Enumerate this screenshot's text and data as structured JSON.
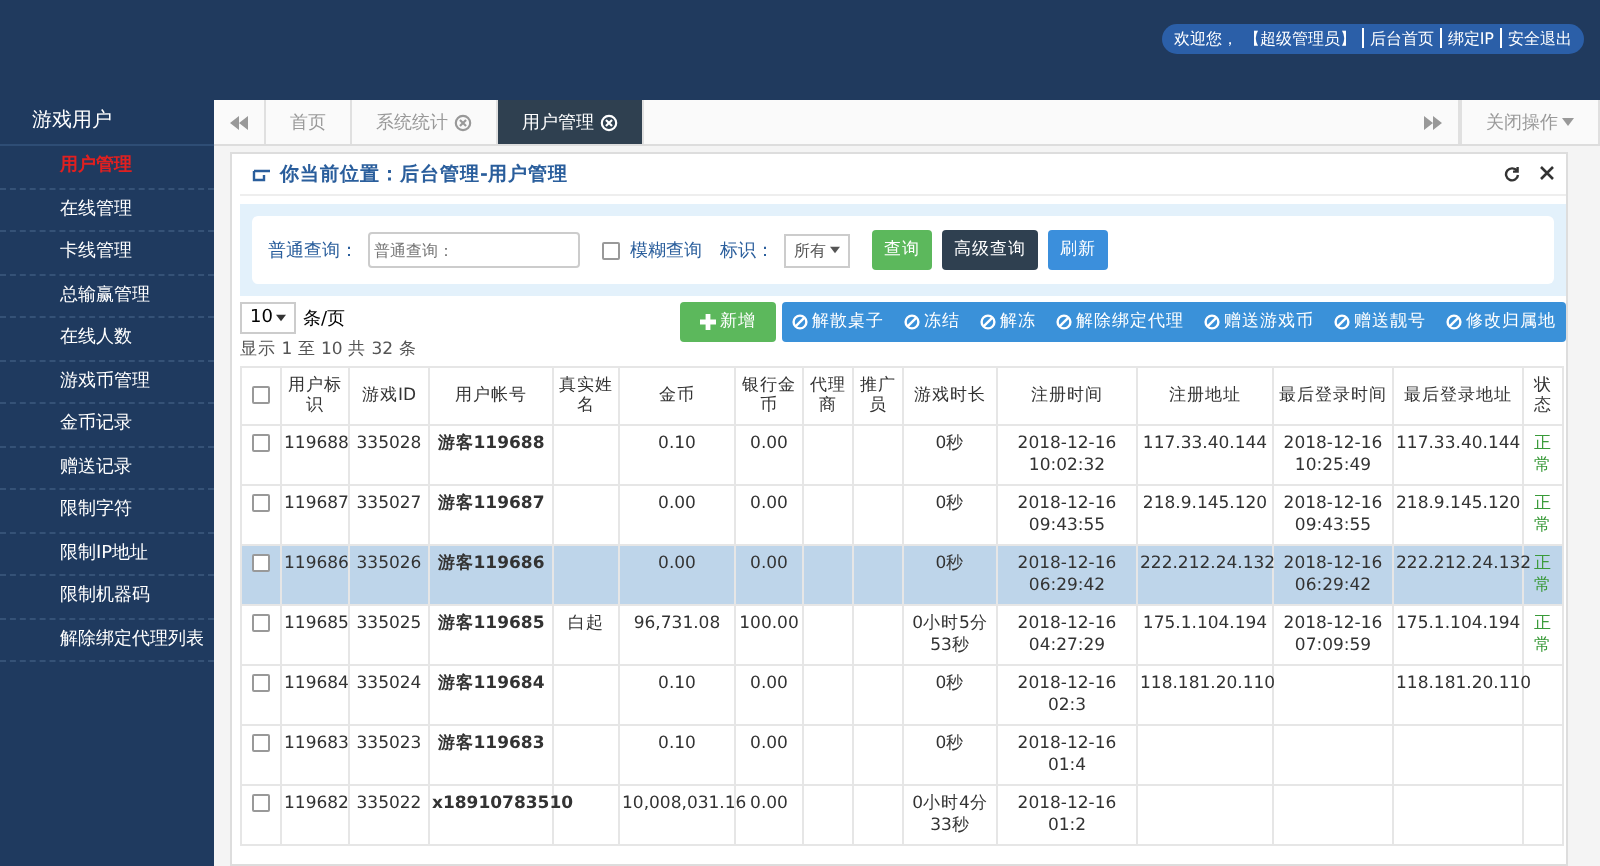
{
  "header": {
    "welcome": "欢迎您，",
    "role": "【超级管理员】",
    "links": [
      "后台首页",
      "绑定IP",
      "安全退出"
    ]
  },
  "sidebar": {
    "title": "游戏用户",
    "items": [
      {
        "label": "用户管理",
        "selected": true
      },
      {
        "label": "在线管理",
        "selected": false
      },
      {
        "label": "卡线管理",
        "selected": false
      },
      {
        "label": "总输赢管理",
        "selected": false
      },
      {
        "label": "在线人数",
        "selected": false
      },
      {
        "label": "游戏币管理",
        "selected": false
      },
      {
        "label": "金币记录",
        "selected": false
      },
      {
        "label": "赠送记录",
        "selected": false
      },
      {
        "label": "限制字符",
        "selected": false
      },
      {
        "label": "限制IP地址",
        "selected": false
      },
      {
        "label": "限制机器码",
        "selected": false
      },
      {
        "label": "解除绑定代理列表",
        "selected": false
      }
    ]
  },
  "tabs": [
    {
      "label": "首页",
      "selected": false,
      "closable": false
    },
    {
      "label": "系统统计",
      "selected": false,
      "closable": true
    },
    {
      "label": "用户管理",
      "selected": true,
      "closable": true
    }
  ],
  "close_menu": "关闭操作",
  "breadcrumb": "你当前位置：后台管理-用户管理",
  "search": {
    "label": "普通查询：",
    "placeholder": "普通查询：",
    "fuzzy": {
      "label": "模糊查询",
      "checked": false
    },
    "flag_label": "标识：",
    "flag_value": "所有",
    "buttons": [
      "查询",
      "高级查询",
      "刷新"
    ]
  },
  "page_size": "10",
  "page_size_unit": "条/页",
  "summary": "显示 1 至 10 共 32 条",
  "add_button": "新增",
  "actions": [
    "解散桌子",
    "冻结",
    "解冻",
    "解除绑定代理",
    "赠送游戏币",
    "赠送靓号",
    "修改归属地"
  ],
  "table": {
    "all_checked": false,
    "columns": [
      "用户标识",
      "游戏ID",
      "用户帐号",
      "真实姓名",
      "金币",
      "银行金币",
      "代理商",
      "推广员",
      "游戏时长",
      "注册时间",
      "注册地址",
      "最后登录时间",
      "最后登录地址",
      "状态"
    ],
    "rows": [
      {
        "selected": false,
        "cells": [
          "119688",
          "335028",
          "游客119688",
          "",
          "0.10",
          "0.00",
          "",
          "",
          "0秒",
          "2018-12-16 10:02:32",
          "117.33.40.144",
          "2018-12-16 10:25:49",
          "117.33.40.144",
          "正常"
        ]
      },
      {
        "selected": false,
        "cells": [
          "119687",
          "335027",
          "游客119687",
          "",
          "0.00",
          "0.00",
          "",
          "",
          "0秒",
          "2018-12-16 09:43:55",
          "218.9.145.120",
          "2018-12-16 09:43:55",
          "218.9.145.120",
          "正常"
        ]
      },
      {
        "selected": true,
        "cells": [
          "119686",
          "335026",
          "游客119686",
          "",
          "0.00",
          "0.00",
          "",
          "",
          "0秒",
          "2018-12-16 06:29:42",
          "222.212.24.132",
          "2018-12-16 06:29:42",
          "222.212.24.132",
          "正常"
        ]
      },
      {
        "selected": false,
        "cells": [
          "119685",
          "335025",
          "游客119685",
          "白起",
          "96,731.08",
          "100.00",
          "",
          "",
          "0小时5分53秒",
          "2018-12-16 04:27:29",
          "175.1.104.194",
          "2018-12-16 07:09:59",
          "175.1.104.194",
          "正常"
        ]
      },
      {
        "selected": false,
        "cells": [
          "119684",
          "335024",
          "游客119684",
          "",
          "0.10",
          "0.00",
          "",
          "",
          "0秒",
          "2018-12-16 02:3",
          "118.181.20.110",
          "",
          "118.181.20.110",
          ""
        ]
      },
      {
        "selected": false,
        "cells": [
          "119683",
          "335023",
          "游客119683",
          "",
          "0.10",
          "0.00",
          "",
          "",
          "0秒",
          "2018-12-16 01:4",
          "",
          "",
          "",
          ""
        ]
      },
      {
        "selected": false,
        "cells": [
          "119682",
          "335022",
          "x18910783510",
          "",
          "10,008,031.16",
          "0.00",
          "",
          "",
          "0小时4分33秒",
          "2018-12-16 01:2",
          "",
          "",
          "",
          ""
        ]
      }
    ]
  }
}
